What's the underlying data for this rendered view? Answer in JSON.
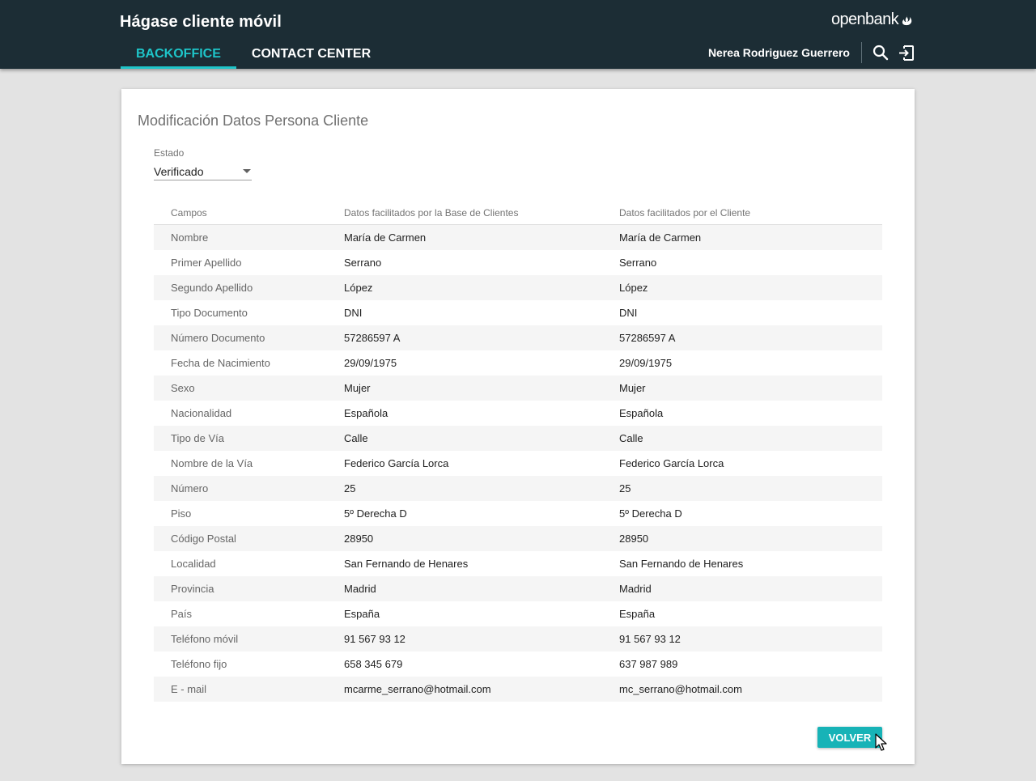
{
  "header": {
    "title": "Hágase cliente móvil",
    "logo_text": "openbank",
    "tabs": [
      {
        "label": "BACKOFFICE",
        "active": true
      },
      {
        "label": "CONTACT CENTER",
        "active": false
      }
    ],
    "user_name": "Nerea Rodriguez Guerrero",
    "icons": [
      "search-icon",
      "logout-icon"
    ]
  },
  "card": {
    "title": "Modificación Datos Persona Cliente",
    "estado": {
      "label": "Estado",
      "value": "Verificado"
    },
    "table": {
      "columns": [
        "Campos",
        "Datos facilitados por la Base de Clientes",
        "Datos facilitados por el Cliente"
      ],
      "rows": [
        [
          "Nombre",
          "María de Carmen",
          "María de Carmen"
        ],
        [
          "Primer Apellido",
          "Serrano",
          "Serrano"
        ],
        [
          "Segundo Apellido",
          "López",
          "López"
        ],
        [
          "Tipo Documento",
          "DNI",
          "DNI"
        ],
        [
          "Número Documento",
          "57286597 A",
          "57286597 A"
        ],
        [
          "Fecha de Nacimiento",
          "29/09/1975",
          "29/09/1975"
        ],
        [
          "Sexo",
          "Mujer",
          "Mujer"
        ],
        [
          "Nacionalidad",
          "Española",
          "Española"
        ],
        [
          "Tipo de Vía",
          "Calle",
          "Calle"
        ],
        [
          "Nombre de la Vía",
          "Federico García Lorca",
          "Federico García Lorca"
        ],
        [
          "Número",
          "25",
          "25"
        ],
        [
          "Piso",
          "5º Derecha D",
          "5º Derecha D"
        ],
        [
          "Código Postal",
          "28950",
          "28950"
        ],
        [
          "Localidad",
          "San Fernando de Henares",
          "San Fernando de Henares"
        ],
        [
          "Provincia",
          "Madrid",
          "Madrid"
        ],
        [
          "País",
          "España",
          "España"
        ],
        [
          "Teléfono móvil",
          "91 567 93 12",
          "91 567 93 12"
        ],
        [
          "Teléfono fijo",
          "658 345 679",
          "637 987 989"
        ],
        [
          "E - mail",
          "mcarme_serrano@hotmail.com",
          "mc_serrano@hotmail.com"
        ]
      ]
    },
    "volver_label": "VOLVER"
  },
  "colors": {
    "header_bg": "#1c2d35",
    "accent": "#1ec5c9",
    "button": "#17b3b7",
    "page_bg": "#e3e3e3"
  }
}
